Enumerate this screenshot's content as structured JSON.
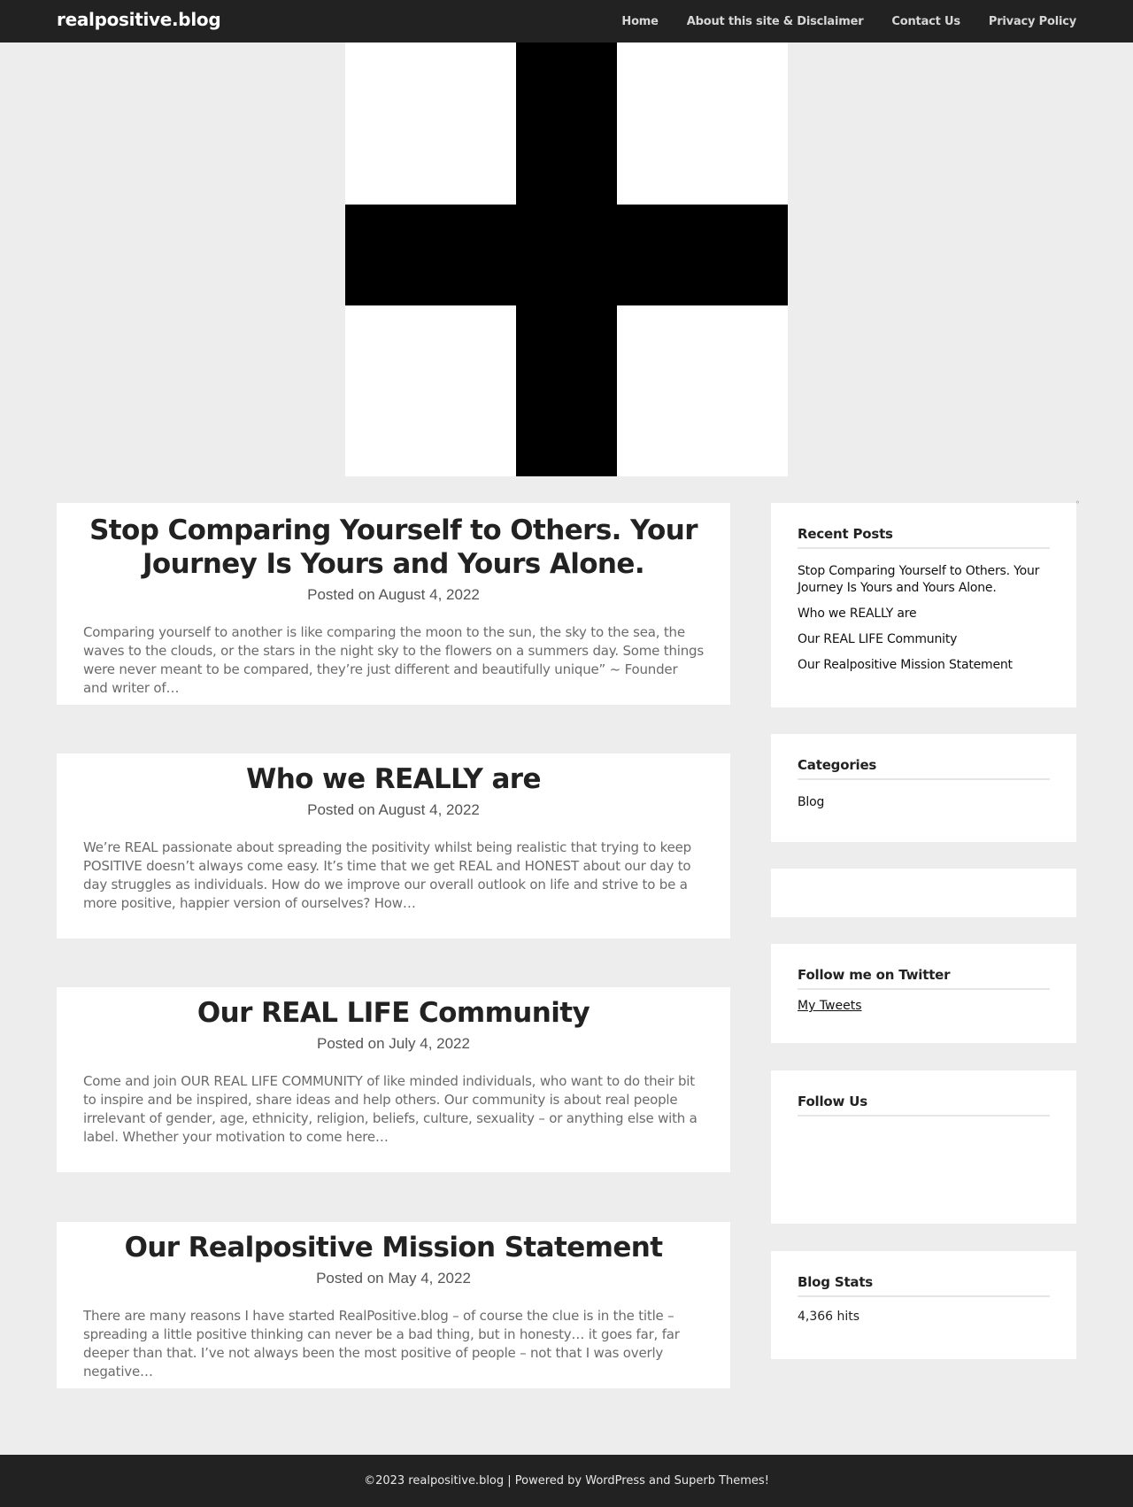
{
  "header": {
    "brand": "realpositive.blog",
    "nav": [
      "Home",
      "About this site & Disclaimer",
      "Contact Us",
      "Privacy Policy"
    ]
  },
  "posts": [
    {
      "title": "Stop Comparing Yourself to Others. Your Journey Is Yours and Yours Alone.",
      "meta": "Posted on August 4, 2022",
      "excerpt": "Comparing yourself to another is like comparing the moon to the sun, the sky to the sea, the waves to the clouds, or the stars in the night sky to the flowers on a summers day. Some things were never meant to be compared, they’re just different and beautifully unique” ~ Founder and writer of…"
    },
    {
      "title": "Who we REALLY are",
      "meta": "Posted on August 4, 2022",
      "excerpt": "We’re REAL passionate about spreading the positivity whilst being realistic that trying to keep POSITIVE doesn’t always come easy. It’s time that we get REAL and HONEST about our day to day struggles as individuals. How do we improve our overall outlook on life and strive to be a more positive, happier version of ourselves? How…"
    },
    {
      "title": "Our REAL LIFE Community",
      "meta": "Posted on July 4, 2022",
      "excerpt": "Come and join OUR REAL LIFE COMMUNITY of like minded individuals, who want to do their bit to inspire and be inspired, share ideas and help others. Our community is about real people irrelevant of gender, age, ethnicity, religion, beliefs, culture, sexuality – or anything else with a label. Whether your motivation to come here…"
    },
    {
      "title": "Our Realpositive Mission Statement",
      "meta": "Posted on May 4, 2022",
      "excerpt": "There are many reasons I have started RealPositive.blog – of course the clue is in the title – spreading a little positive thinking can never be a bad thing, but in honesty… it goes far, far deeper than that. I’ve not always been the most positive of people – not that I was overly negative…"
    }
  ],
  "sidebar": {
    "recent_title": "Recent Posts",
    "recent": [
      "Stop Comparing Yourself to Others. Your Journey Is Yours and Yours Alone.",
      "Who we REALLY are",
      "Our REAL LIFE Community",
      "Our Realpositive Mission Statement"
    ],
    "categories_title": "Categories",
    "categories": [
      "Blog"
    ],
    "twitter_title": "Follow me on Twitter",
    "twitter_link": "My Tweets",
    "follow_title": "Follow Us",
    "stats_title": "Blog Stats",
    "stats_value": "4,366 hits"
  },
  "footer": {
    "text": "©2023 realpositive.blog | Powered by WordPress and Superb Themes!"
  }
}
